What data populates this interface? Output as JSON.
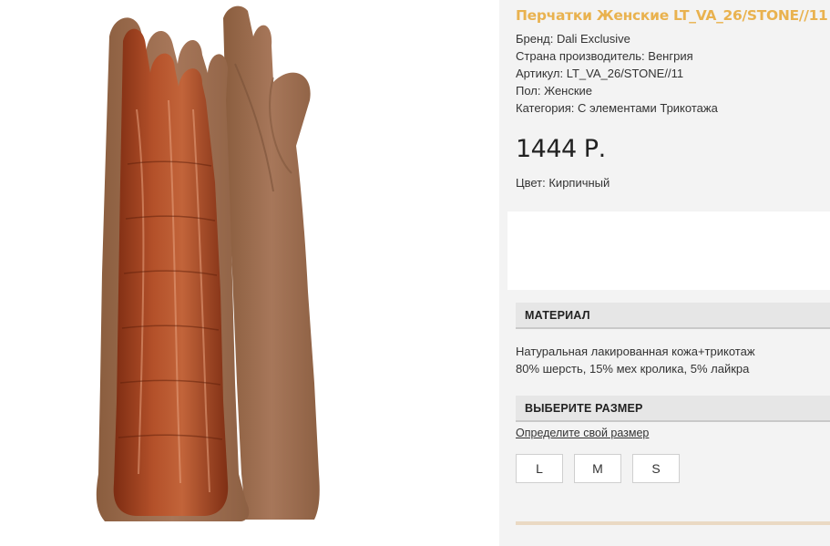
{
  "product": {
    "title": "Перчатки Женские LT_VA_26/STONE//11",
    "specs": [
      "Бренд: Dali Exclusive",
      "Страна производитель: Венгрия",
      "Артикул: LT_VA_26/STONE//11",
      "Пол: Женские",
      "Категория: С элементами Трикотажа"
    ],
    "price": "1444 Р.",
    "color": "Цвет: Кирпичный"
  },
  "material": {
    "heading": "МАТЕРИАЛ",
    "lines": [
      "Натуральная лакированная кожа+трикотаж",
      "80% шерсть, 15% мех кролика, 5% лайкра"
    ]
  },
  "size": {
    "heading": "ВЫБЕРИТЕ РАЗМЕР",
    "link": "Определите свой размер",
    "options": [
      "L",
      "M",
      "S"
    ]
  },
  "colors": {
    "title": "#e9b24f",
    "leather": "#a5431f",
    "knit": "#a1714f"
  },
  "image": {
    "icon": "gloves-product-image"
  }
}
